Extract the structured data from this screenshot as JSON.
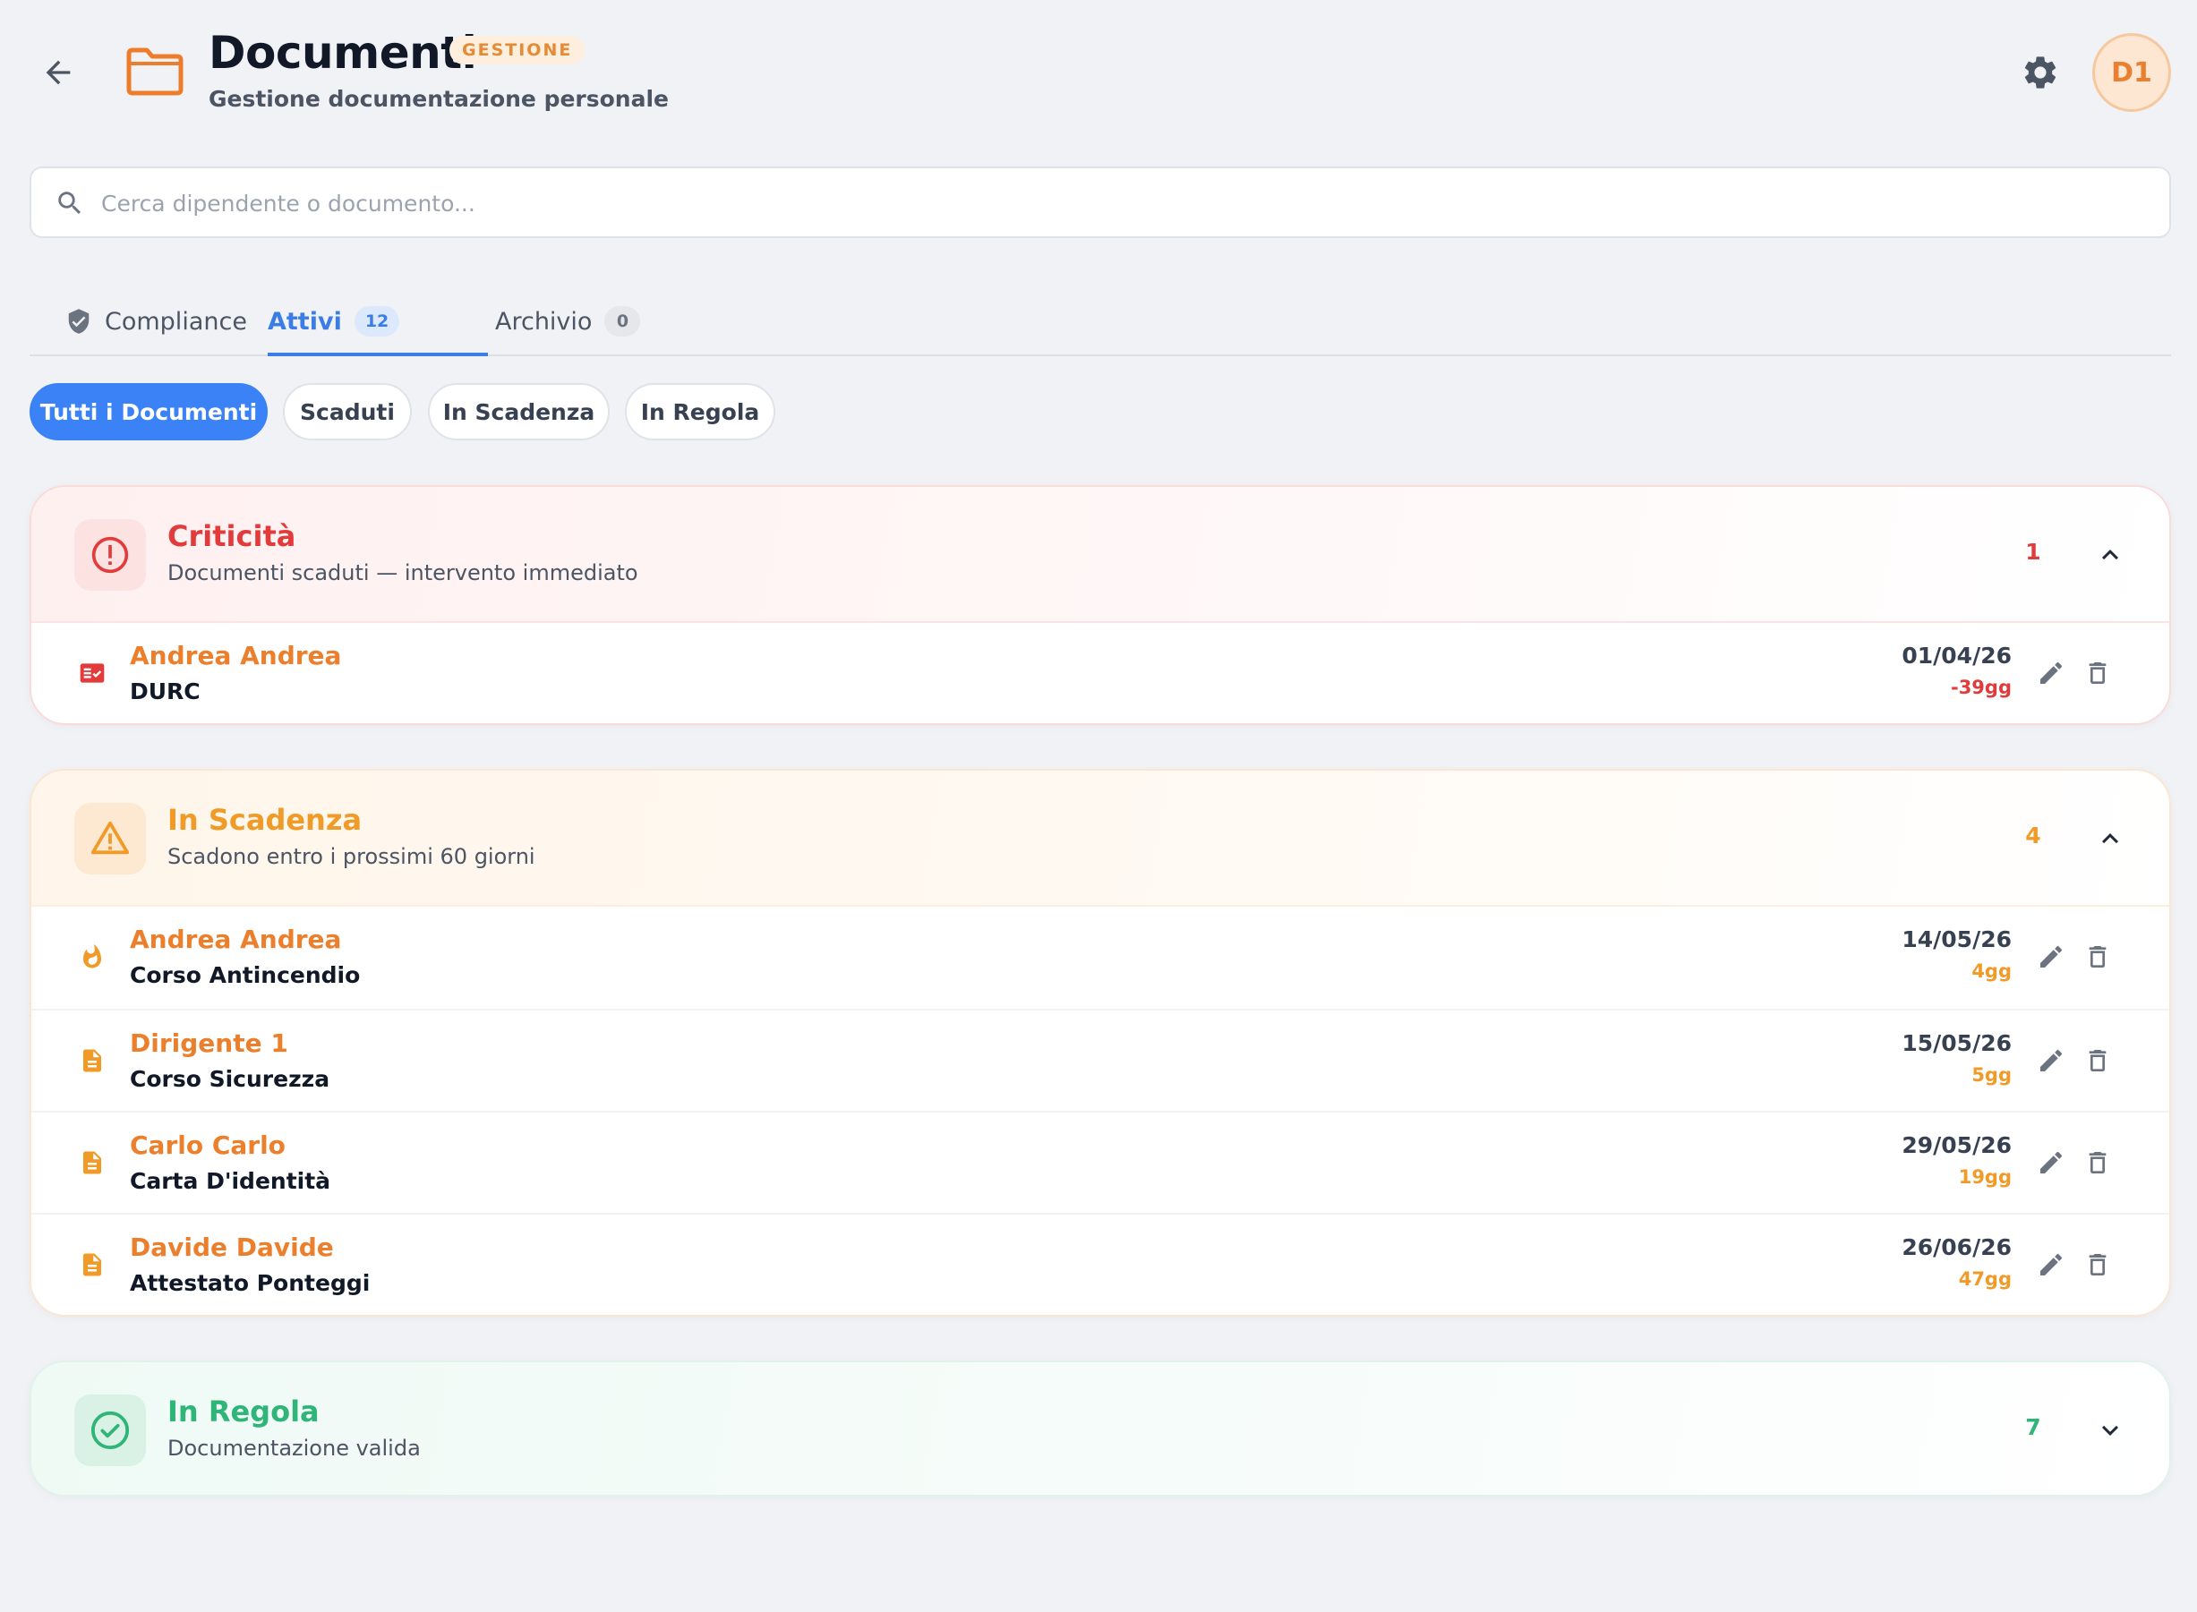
{
  "header": {
    "title": "Documenti",
    "badge": "GESTIONE",
    "subtitle": "Gestione documentazione personale",
    "avatar_initials": "D1"
  },
  "search": {
    "placeholder": "Cerca dipendente o documento...",
    "value": ""
  },
  "tabs": [
    {
      "label": "Compliance",
      "icon": "shield-icon"
    },
    {
      "label": "Attivi",
      "count": "12",
      "active": true
    },
    {
      "label": "Archivio",
      "count": "0"
    }
  ],
  "filters": [
    {
      "label": "Tutti i Documenti",
      "active": true
    },
    {
      "label": "Scaduti"
    },
    {
      "label": "In Scadenza"
    },
    {
      "label": "In Regola"
    }
  ],
  "sections": {
    "critical": {
      "title": "Criticità",
      "subtitle": "Documenti scaduti — intervento immediato",
      "count": "1",
      "icon": "alert-circle-icon",
      "color": "#e23b3b",
      "rows": [
        {
          "name": "Andrea Andrea",
          "document": "DURC",
          "date": "01/04/26",
          "days": "-39gg",
          "icon": "checklist-icon"
        }
      ]
    },
    "expiring": {
      "title": "In Scadenza",
      "subtitle": "Scadono entro i prossimi 60 giorni",
      "count": "4",
      "icon": "warning-triangle-icon",
      "color": "#f09a28",
      "rows": [
        {
          "name": "Andrea Andrea",
          "document": "Corso Antincendio",
          "date": "14/05/26",
          "days": "4gg",
          "icon": "fire-icon"
        },
        {
          "name": "Dirigente 1",
          "document": "Corso Sicurezza",
          "date": "15/05/26",
          "days": "5gg",
          "icon": "document-icon"
        },
        {
          "name": "Carlo Carlo",
          "document": "Carta D'identità",
          "date": "29/05/26",
          "days": "19gg",
          "icon": "document-icon"
        },
        {
          "name": "Davide Davide",
          "document": "Attestato Ponteggi",
          "date": "26/06/26",
          "days": "47gg",
          "icon": "document-icon"
        }
      ]
    },
    "valid": {
      "title": "In Regola",
      "subtitle": "Documentazione valida",
      "count": "7",
      "icon": "check-circle-icon",
      "color": "#2fb577"
    }
  },
  "colors": {
    "accent": "#3b82f6",
    "name_orange": "#ec7f2c",
    "background": "#f1f2f6"
  }
}
